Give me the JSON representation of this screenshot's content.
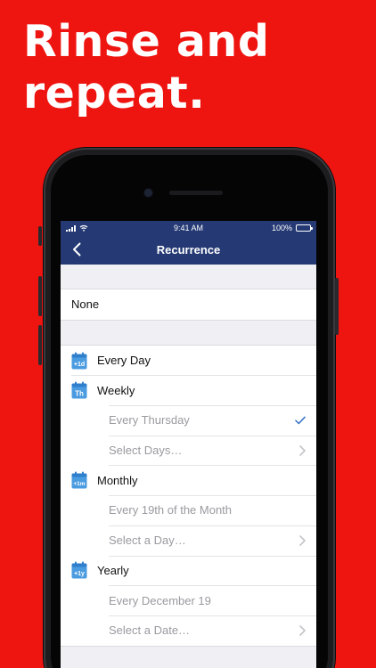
{
  "headline": {
    "line1": "Rinse and",
    "line2": "repeat."
  },
  "status_bar": {
    "time": "9:41 AM",
    "battery": "100%"
  },
  "nav": {
    "title": "Recurrence"
  },
  "none_option": {
    "label": "None"
  },
  "options": {
    "every_day": {
      "label": "Every Day",
      "icon_text": "+1d"
    },
    "weekly": {
      "label": "Weekly",
      "icon_text": "Th",
      "every": "Every Thursday",
      "select": "Select Days…"
    },
    "monthly": {
      "label": "Monthly",
      "icon_text": "+1m",
      "every": "Every 19th of the Month",
      "select": "Select a Day…"
    },
    "yearly": {
      "label": "Yearly",
      "icon_text": "+1y",
      "every": "Every December 19",
      "select": "Select a Date…"
    }
  },
  "colors": {
    "background": "#ee1410",
    "navbar": "#253a74",
    "accent": "#3a78c9",
    "icon_blue": "#4a9be0"
  }
}
